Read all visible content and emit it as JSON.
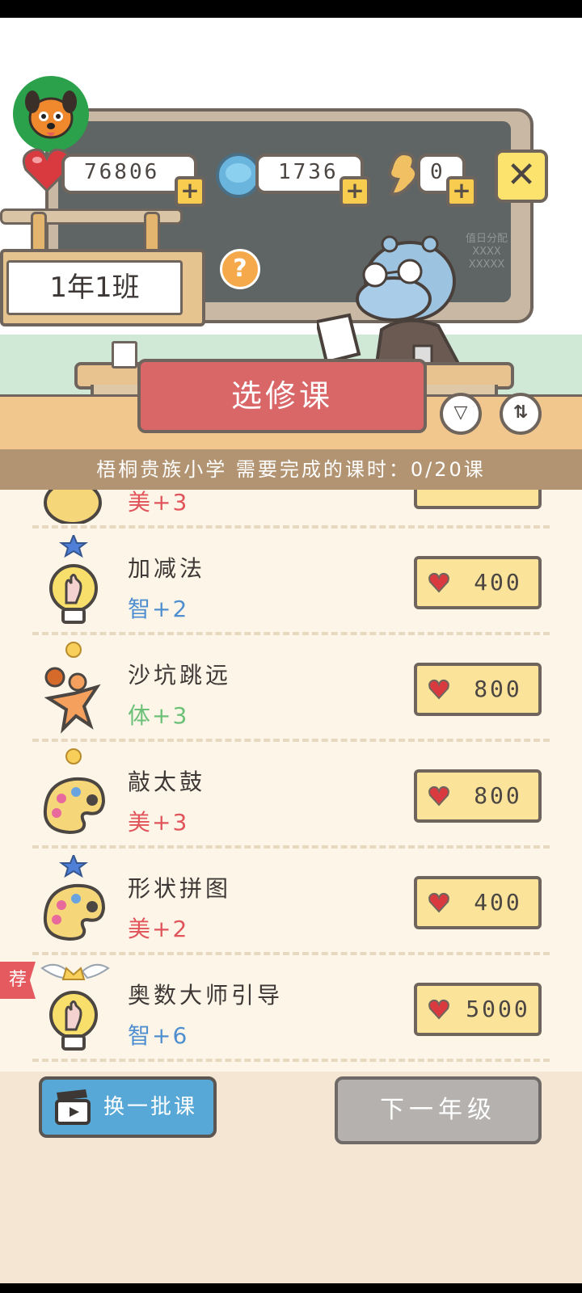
{
  "hud": {
    "hearts": "76806",
    "coins": "1736",
    "energy": "0",
    "plus_label": "+",
    "close_label": "✕"
  },
  "scene": {
    "class_name": "1年1班",
    "help_label": "?",
    "board_note_1": "值日分配",
    "board_note_2": "XXXX",
    "board_note_3": "XXXXX"
  },
  "header": {
    "title": "选修课",
    "filter_icon": "▽",
    "sort_icon": "⇅",
    "info": "梧桐贵族小学 需要完成的课时：0/20课"
  },
  "courses": [
    {
      "name": "",
      "stat": "美+3",
      "stat_color": "#e0545a",
      "price": "",
      "icon": "palette-icon"
    },
    {
      "name": "加减法",
      "stat": "智+2",
      "stat_color": "#4f8fd0",
      "price": "400",
      "icon": "lightbulb-icon",
      "badge": "blue-star"
    },
    {
      "name": "沙坑跳远",
      "stat": "体+3",
      "stat_color": "#6cc078",
      "price": "800",
      "icon": "athlete-icon",
      "badge": "gold-star"
    },
    {
      "name": "敲太鼓",
      "stat": "美+3",
      "stat_color": "#e0545a",
      "price": "800",
      "icon": "palette-icon",
      "badge": "gold-star"
    },
    {
      "name": "形状拼图",
      "stat": "美+2",
      "stat_color": "#e0545a",
      "price": "400",
      "icon": "palette-icon",
      "badge": "blue-star"
    },
    {
      "name": "奥数大师引导",
      "stat": "智+6",
      "stat_color": "#4f8fd0",
      "price": "5000",
      "icon": "lightbulb-icon",
      "badge": "crown-wings",
      "recommended": "荐"
    }
  ],
  "footer": {
    "swap_label": "换一批课",
    "next_grade_label": "下一年级"
  }
}
